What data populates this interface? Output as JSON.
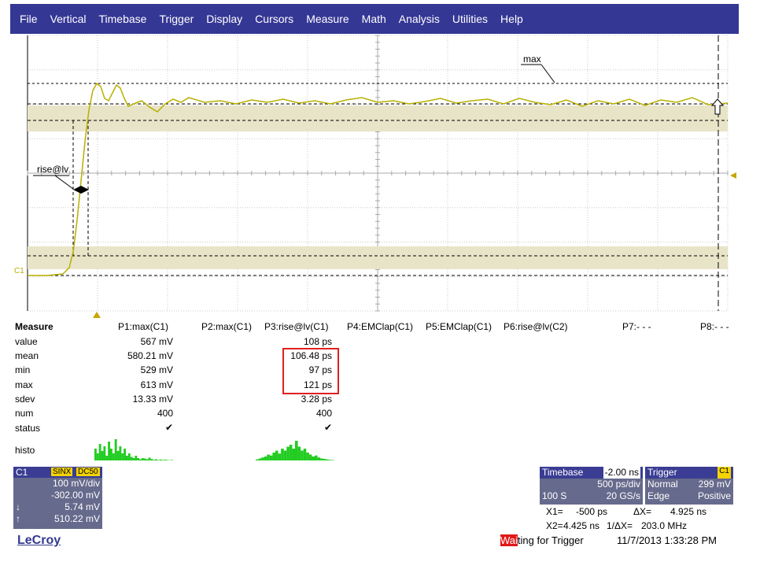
{
  "menu": [
    "File",
    "Vertical",
    "Timebase",
    "Trigger",
    "Display",
    "Cursors",
    "Measure",
    "Math",
    "Analysis",
    "Utilities",
    "Help"
  ],
  "colors": {
    "menubar": "#353795",
    "trace_c1": "#b8b000",
    "band": "#e8e4c8",
    "histogram": "#22cc22",
    "highlight": "#e02020"
  },
  "waveform": {
    "channel_marker": "C1",
    "annotation_max": "max",
    "annotation_rise": "rise@lv"
  },
  "measure": {
    "title": "Measure",
    "params": [
      "P1:max(C1)",
      "P2:max(C1)",
      "P3:rise@lv(C1)",
      "P4:EMClap(C1)",
      "P5:EMClap(C1)",
      "P6:rise@lv(C2)",
      "P7:- - -",
      "P8:- - -"
    ],
    "row_labels": [
      "value",
      "mean",
      "min",
      "max",
      "sdev",
      "num",
      "status",
      "histo"
    ],
    "p1": [
      "567 mV",
      "580.21 mV",
      "529 mV",
      "613 mV",
      "13.33 mV",
      "400"
    ],
    "p3": [
      "108 ps",
      "106.48 ps",
      "97 ps",
      "121 ps",
      "3.28 ps",
      "400"
    ],
    "status_p1": "✔",
    "status_p3": "✔"
  },
  "channel": {
    "label": "C1",
    "tag1": "SINX",
    "tag2": "DC50",
    "scale": "100 mV/div",
    "offset": "-302.00 mV",
    "cursor1_arrow": "↓",
    "cursor1": "5.74 mV",
    "cursor2_arrow": "↑",
    "cursor2": "510.22 mV"
  },
  "brand": "LeCroy",
  "timebase": {
    "label": "Timebase",
    "delay": "-2.00 ns",
    "per_div": "500 ps/div",
    "samples": "100 S",
    "rate": "20 GS/s"
  },
  "trigger": {
    "label": "Trigger",
    "source": "C1",
    "mode": "Normal",
    "level": "299 mV",
    "type": "Edge",
    "slope": "Positive"
  },
  "cursors": {
    "x1_label": "X1=",
    "x1": "-500 ps",
    "dx_label": "ΔX=",
    "dx": "4.925 ns",
    "x2_label": "X2=",
    "x2": "4.425 ns",
    "inv_dx_label": "1/ΔX=",
    "inv_dx": "203.0 MHz"
  },
  "status": {
    "wait_highlight": "Wai",
    "wait_rest": "ting for Trigger",
    "datetime": "11/7/2013 1:33:28 PM"
  }
}
